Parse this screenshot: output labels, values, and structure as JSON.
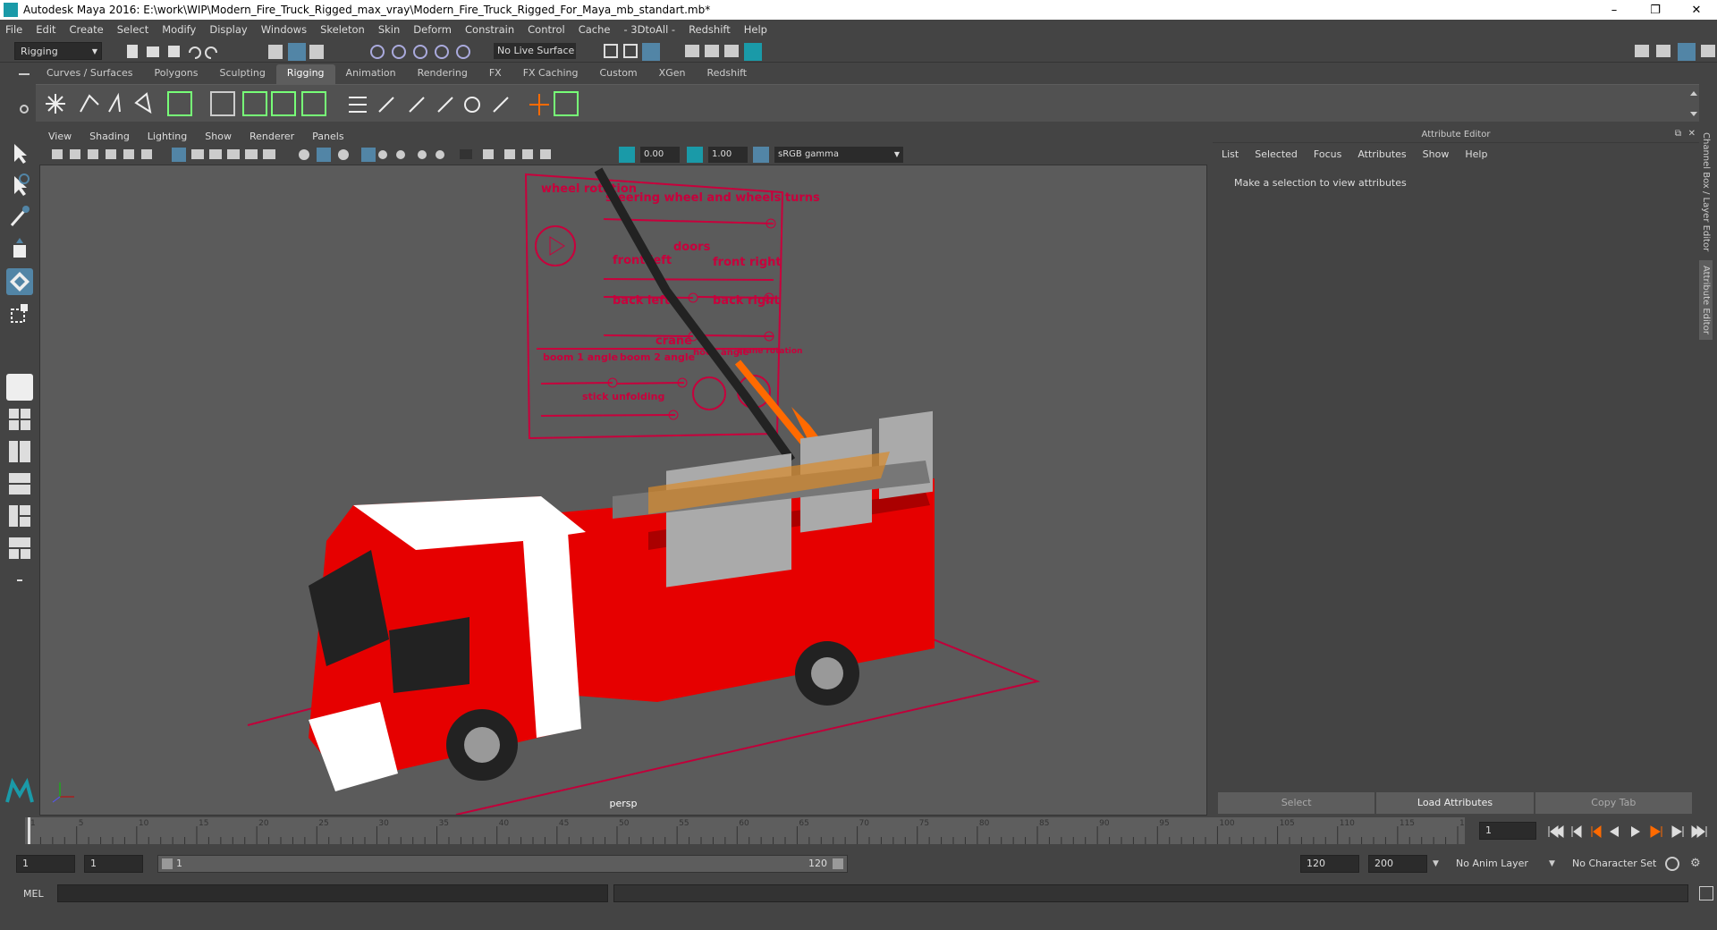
{
  "window": {
    "title": "Autodesk Maya 2016: E:\\work\\WIP\\Modern_Fire_Truck_Rigged_max_vray\\Modern_Fire_Truck_Rigged_For_Maya_mb_standart.mb*",
    "minimize": "–",
    "restore": "❐",
    "close": "✕"
  },
  "menubar": [
    "File",
    "Edit",
    "Create",
    "Select",
    "Modify",
    "Display",
    "Windows",
    "Skeleton",
    "Skin",
    "Deform",
    "Constrain",
    "Control",
    "Cache",
    "- 3DtoAll -",
    "Redshift",
    "Help"
  ],
  "statusline": {
    "mode": "Rigging",
    "live_surface": "No Live Surface"
  },
  "shelf_tabs": [
    {
      "label": "Curves / Surfaces",
      "active": false
    },
    {
      "label": "Polygons",
      "active": false
    },
    {
      "label": "Sculpting",
      "active": false
    },
    {
      "label": "Rigging",
      "active": true
    },
    {
      "label": "Animation",
      "active": false
    },
    {
      "label": "Rendering",
      "active": false
    },
    {
      "label": "FX",
      "active": false
    },
    {
      "label": "FX Caching",
      "active": false
    },
    {
      "label": "Custom",
      "active": false
    },
    {
      "label": "XGen",
      "active": false
    },
    {
      "label": "Redshift",
      "active": false
    }
  ],
  "viewport": {
    "menu": [
      "View",
      "Shading",
      "Lighting",
      "Show",
      "Renderer",
      "Panels"
    ],
    "exposure": "0.00",
    "gamma": "1.00",
    "colorspace": "sRGB gamma",
    "camera_label": "persp"
  },
  "controls_panel": {
    "wheel_rotation": "wheel rotation",
    "steering": "steering wheel and wheels turns",
    "front_left": "front left",
    "doors": "doors",
    "front_right": "front right",
    "back_left": "back left",
    "back_right": "back right",
    "crane": "crane",
    "boom1": "boom 1 angle",
    "boom2": "boom 2 angle",
    "hook_angle": "hook angle",
    "crane_rotation": "crane rotation",
    "stick_unfolding": "stick unfolding"
  },
  "attribute_editor": {
    "header": "Attribute Editor",
    "menu": [
      "List",
      "Selected",
      "Focus",
      "Attributes",
      "Show",
      "Help"
    ],
    "message": "Make a selection to view attributes",
    "buttons": [
      "Select",
      "Load Attributes",
      "Copy Tab"
    ]
  },
  "side_tabs": [
    "Channel Box / Layer Editor",
    "Attribute Editor"
  ],
  "timeline": {
    "ticks": [
      1,
      5,
      10,
      15,
      20,
      25,
      30,
      35,
      40,
      45,
      50,
      55,
      60,
      65,
      70,
      75,
      80,
      85,
      90,
      95,
      100,
      105,
      110,
      115,
      120
    ],
    "current_frame": "1"
  },
  "range": {
    "start": "1",
    "start2": "1",
    "slider_start": "1",
    "slider_end": "120",
    "end": "120",
    "end2": "200",
    "anim_layer": "No Anim Layer",
    "character_set": "No Character Set"
  },
  "cmdline": {
    "label": "MEL"
  },
  "colors": {
    "accent": "#5285a6",
    "truck_red": "#e60000",
    "controls_red": "#c8003c",
    "crane_orange": "#ff6a00"
  }
}
